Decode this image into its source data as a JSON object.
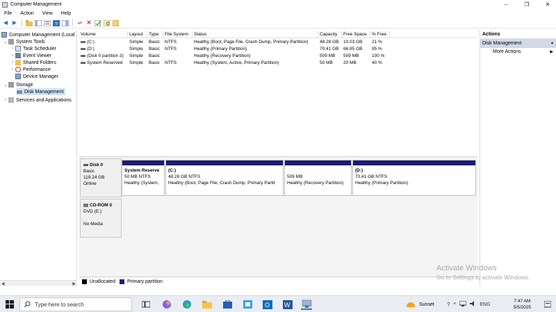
{
  "window": {
    "title": "Computer Management",
    "minimize": "–",
    "maximize": "❐",
    "close": "✕"
  },
  "menu": [
    "File",
    "Action",
    "View",
    "Help"
  ],
  "tree": {
    "root": "Computer Management (Local",
    "system_tools": "System Tools",
    "task_scheduler": "Task Scheduler",
    "event_viewer": "Event Viewer",
    "shared_folders": "Shared Folders",
    "performance": "Performance",
    "device_manager": "Device Manager",
    "storage": "Storage",
    "disk_management": "Disk Management",
    "services": "Services and Applications"
  },
  "volume_table": {
    "headers": [
      "Volume",
      "Layout",
      "Type",
      "File System",
      "Status",
      "Capacity",
      "Free Space",
      "% Free"
    ],
    "rows": [
      [
        "(C:)",
        "Simple",
        "Basic",
        "NTFS",
        "Healthy (Boot, Page File, Crash Dump, Primary Partition)",
        "48.28 GB",
        "10.03 GB",
        "21 %"
      ],
      [
        "(D:)",
        "Simple",
        "Basic",
        "NTFS",
        "Healthy (Primary Partition)",
        "70.41 GB",
        "66.85 GB",
        "95 %"
      ],
      [
        "(Disk 0 partition 3)",
        "Simple",
        "Basic",
        "",
        "Healthy (Recovery Partition)",
        "509 MB",
        "509 MB",
        "100 %"
      ],
      [
        "System Reserved",
        "Simple",
        "Basic",
        "NTFS",
        "Healthy (System, Active, Primary Partition)",
        "50 MB",
        "20 MB",
        "40 %"
      ]
    ]
  },
  "disk0": {
    "name": "Disk 0",
    "type": "Basic",
    "size": "119.24 GB",
    "status": "Online",
    "partitions": [
      {
        "name": "System Reserve",
        "size": "50 MB NTFS",
        "status": "Healthy (System,"
      },
      {
        "name": "(C:)",
        "size": "48.28 GB NTFS",
        "status": "Healthy (Boot, Page File, Crash Dump, Primary Partit"
      },
      {
        "name": "",
        "size": "509 MB",
        "status": "Healthy (Recovery Partition)"
      },
      {
        "name": "(D:)",
        "size": "70.41 GB NTFS",
        "status": "Healthy (Primary Partition)"
      }
    ]
  },
  "cdrom": {
    "name": "CD-ROM 0",
    "type": "DVD (E:)",
    "media": "No Media"
  },
  "legend": {
    "unallocated": "Unallocated",
    "primary": "Primary partition",
    "unallocated_color": "#000000",
    "primary_color": "#1a1a7a"
  },
  "actions": {
    "title": "Actions",
    "section": "Disk Management",
    "more": "More Actions"
  },
  "watermark": {
    "line1": "Activate Windows",
    "line2": "Go to Settings to activate Windows."
  },
  "taskbar": {
    "search_placeholder": "Type here to search",
    "weather": "Sunset",
    "language": "ENG",
    "time": "7:47 AM",
    "date": "5/5/2025"
  }
}
